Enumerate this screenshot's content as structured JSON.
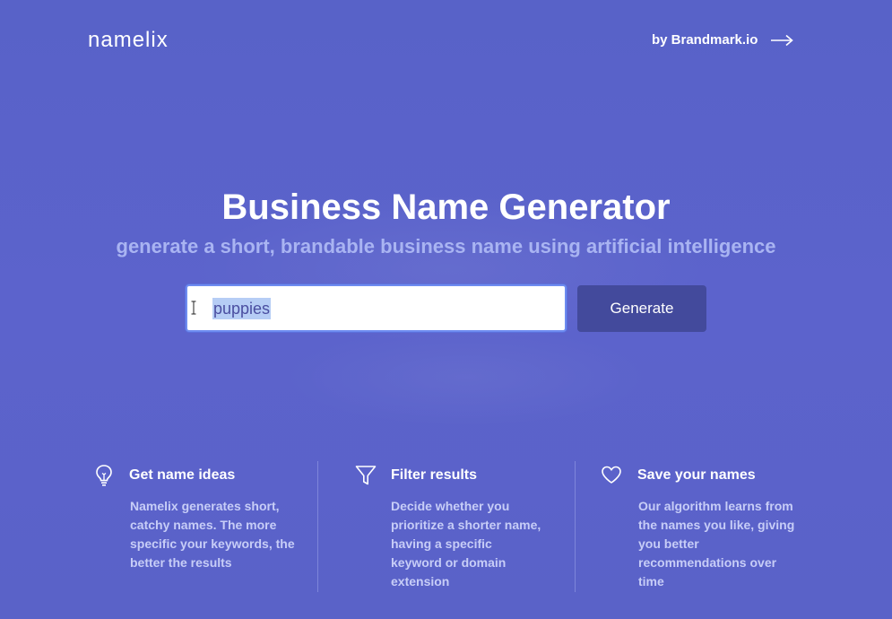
{
  "header": {
    "logo": "namelix",
    "by_link": "by Brandmark.io"
  },
  "hero": {
    "title": "Business Name Generator",
    "subtitle": "generate a short, brandable business name using artificial intelligence"
  },
  "search": {
    "value": "puppies",
    "button_label": "Generate"
  },
  "features": [
    {
      "icon": "lightbulb-icon",
      "title": "Get name ideas",
      "description": "Namelix generates short, catchy names. The more specific your keywords, the better the results"
    },
    {
      "icon": "filter-icon",
      "title": "Filter results",
      "description": "Decide whether you prioritize a shorter name, having a specific keyword or domain extension"
    },
    {
      "icon": "heart-icon",
      "title": "Save your names",
      "description": "Our algorithm learns from the names you like, giving you better recommendations over time"
    }
  ],
  "colors": {
    "background": "#5a63c9",
    "subtitle": "#a9b4f2",
    "button": "#434a9c",
    "selection": "#b6cdf5"
  }
}
